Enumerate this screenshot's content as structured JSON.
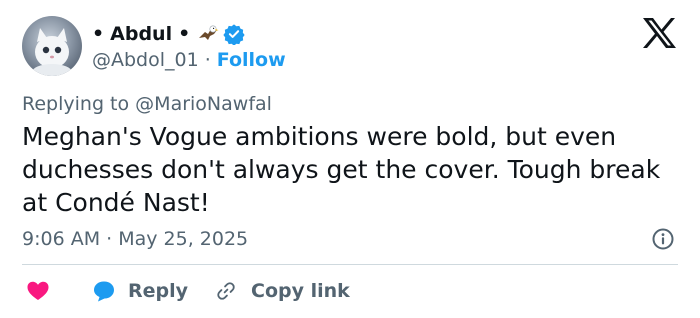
{
  "author": {
    "display_name_prefix": "•",
    "display_name": "Abdul",
    "display_name_suffix": "•",
    "handle": "@Abdol_01",
    "separator": "·",
    "follow_label": "Follow",
    "verified_color": "#1d9bf0"
  },
  "tweet": {
    "replying_to_label": "Replying to",
    "replying_to_handle": "@MarioNawfal",
    "text": "Meghan's Vogue ambitions were bold, but even duchesses don't always get the cover. Tough break at Condé Nast!",
    "timestamp": "9:06 AM · May 25, 2025"
  },
  "actions": {
    "reply_label": "Reply",
    "copy_link_label": "Copy link",
    "like_color": "#f91880",
    "reply_color": "#1d9bf0"
  },
  "icons": [
    "avatar-cat-image",
    "eagle-emoji",
    "verified-badge",
    "x-logo",
    "info-icon",
    "heart-icon",
    "reply-bubble-icon",
    "link-icon"
  ]
}
